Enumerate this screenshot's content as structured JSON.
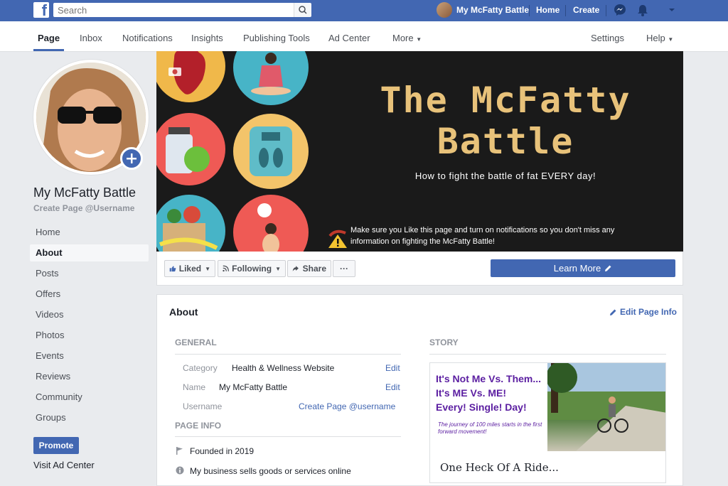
{
  "topbar": {
    "logo": "f",
    "search_placeholder": "Search",
    "profile_name": "My McFatty Battle",
    "links": [
      "Home",
      "Create"
    ]
  },
  "tabs": [
    "Page",
    "Inbox",
    "Notifications",
    "Insights",
    "Publishing Tools",
    "Ad Center",
    "More",
    "Settings",
    "Help"
  ],
  "page": {
    "name": "My McFatty Battle",
    "username_prompt": "Create Page @Username"
  },
  "sidebar": [
    "Home",
    "About",
    "Posts",
    "Offers",
    "Videos",
    "Photos",
    "Events",
    "Reviews",
    "Community",
    "Groups"
  ],
  "sidebar_active": "About",
  "promote": "Promote",
  "visit_ad_center": "Visit Ad Center",
  "cover": {
    "title_line1": "The McFatty",
    "title_line2": "Battle",
    "subtitle": "How to fight the battle of fat EVERY day!",
    "note": "Make sure you Like this page and turn on notifications so you don't miss any information on fighting the McFatty Battle!"
  },
  "actions": {
    "liked": "Liked",
    "following": "Following",
    "share": "Share",
    "more": "···",
    "learn_more": "Learn More"
  },
  "about": {
    "title": "About",
    "edit_info": "Edit Page Info",
    "general_head": "GENERAL",
    "rows": [
      {
        "label": "Category",
        "value": "Health & Wellness Website",
        "action": "Edit"
      },
      {
        "label": "Name",
        "value": "My McFatty Battle",
        "action": "Edit"
      },
      {
        "label": "Username",
        "value": "",
        "action": "Create Page @username"
      }
    ],
    "page_info_head": "PAGE INFO",
    "founded": "Founded in 2019",
    "business": "My business sells goods or services online",
    "story_head": "STORY",
    "story_lines": [
      "It's Not Me Vs. Them...",
      "It's ME Vs. ME!",
      "Every! Single! Day!"
    ],
    "story_small": "The journey of 100 miles starts in the first forward movement!",
    "story_caption": "One Heck Of A Ride..."
  },
  "colors": {
    "brand": "#4267b2",
    "cover_title": "#e8c27a",
    "story_purple": "#5b1ea1"
  }
}
